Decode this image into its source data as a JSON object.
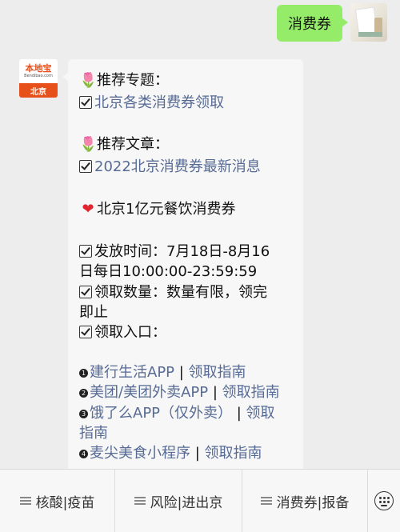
{
  "outgoing_message": "消费券",
  "bot": {
    "logo_name": "本地宝",
    "logo_url": "Bendibao.com",
    "logo_city": "北京"
  },
  "reply": {
    "section1_title": "推荐专题：",
    "section1_link": "北京各类消费券领取",
    "section2_title": "推荐文章：",
    "section2_link": "2022北京消费券最新消息",
    "headline": "北京1亿元餐饮消费券",
    "release_time_1": "发放时间：7月18日-8月16",
    "release_time_2": "日每日10:00:00-23:59:59",
    "quantity_1": "领取数量：数量有限，领完",
    "quantity_2": "即止",
    "entry": "领取入口：",
    "sep": " | ",
    "entries": [
      {
        "num": "1",
        "name": "建行生活APP",
        "guide": "领取指南"
      },
      {
        "num": "2",
        "name": "美团/美团外卖APP",
        "guide": "领取指南"
      },
      {
        "num": "3",
        "name": "饿了么APP（仅外卖）",
        "guide_part1": "领取",
        "guide_part2": "指南"
      },
      {
        "num": "4",
        "name": "麦尖美食小程序",
        "guide": "领取指南"
      }
    ]
  },
  "menu": [
    "核酸|疫苗",
    "风险|进出京",
    "消费券|报备"
  ],
  "icons": [
    "tulip-icon",
    "heart-icon",
    "checkbox-icon",
    "menu-lines-icon",
    "keyboard-icon"
  ],
  "colors": {
    "outgoing_bubble": "#95ec69",
    "link": "#576b95",
    "brand": "#e8501b"
  }
}
